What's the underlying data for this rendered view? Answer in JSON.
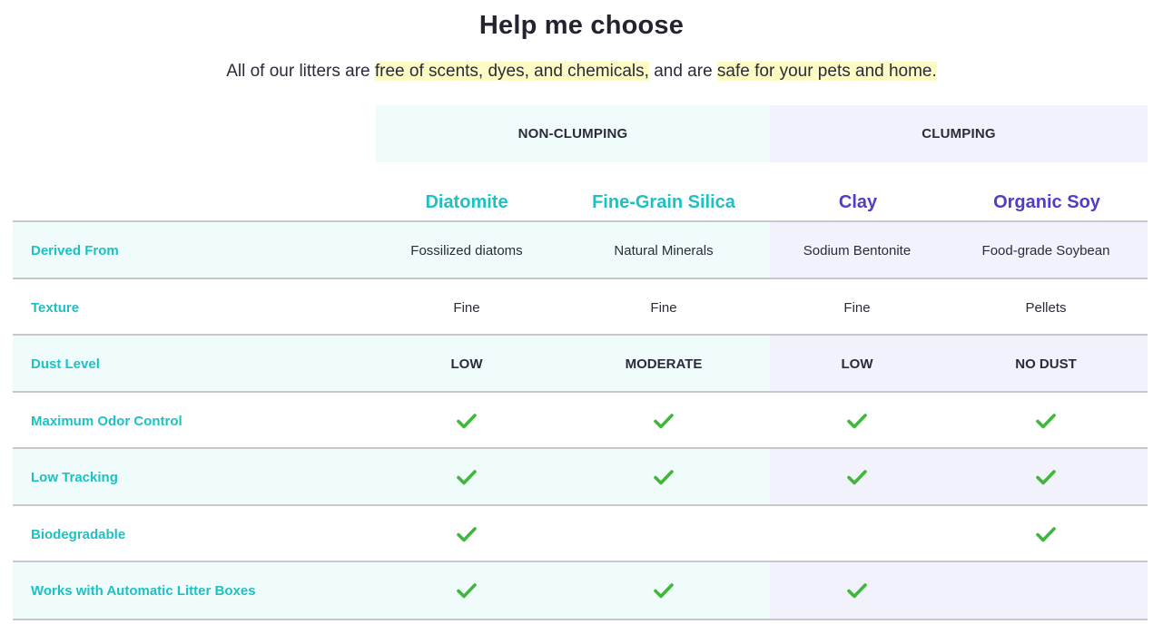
{
  "header": {
    "title": "Help me choose",
    "subtitle_parts": {
      "p1": "All of our litters are ",
      "h1": "free of scents, dyes, and chemicals,",
      "p2": " and are ",
      "h2": "safe for your pets and home."
    }
  },
  "groups": {
    "non_clumping": "NON-CLUMPING",
    "clumping": "CLUMPING"
  },
  "products": [
    "Diatomite",
    "Fine-Grain Silica",
    "Clay",
    "Organic Soy"
  ],
  "colors": {
    "teal": "#1ec0c4",
    "purple": "#4f3ec8",
    "check": "#3fb83a",
    "non_clumping_bg": "#f0fbfc",
    "clumping_bg": "#f2f2fc",
    "highlight": "#fdfbc4"
  },
  "icons": {
    "check": "checkmark-icon"
  },
  "rows": [
    {
      "label": "Derived From",
      "values": [
        "Fossilized diatoms",
        "Natural Minerals",
        "Sodium Bentonite",
        "Food-grade Soybean"
      ]
    },
    {
      "label": "Texture",
      "values": [
        "Fine",
        "Fine",
        "Fine",
        "Pellets"
      ]
    },
    {
      "label": "Dust Level",
      "values": [
        "LOW",
        "MODERATE",
        "LOW",
        "NO DUST"
      ]
    },
    {
      "label": "Maximum Odor Control",
      "checks": [
        true,
        true,
        true,
        true
      ]
    },
    {
      "label": "Low Tracking",
      "checks": [
        true,
        true,
        true,
        true
      ]
    },
    {
      "label": "Biodegradable",
      "checks": [
        true,
        false,
        false,
        true
      ]
    },
    {
      "label": "Works with Automatic Litter Boxes",
      "checks": [
        true,
        true,
        true,
        false
      ]
    }
  ]
}
